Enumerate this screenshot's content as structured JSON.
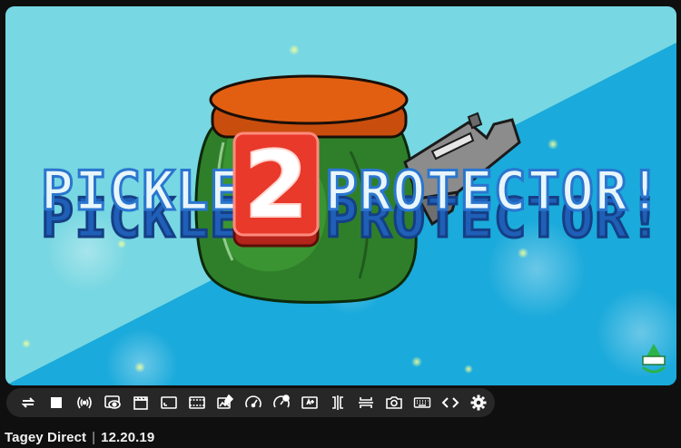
{
  "video": {
    "title_left": "PICKLE",
    "title_number": "2",
    "title_right": "PROTECTOR!",
    "colors": {
      "sky_light": "#77d7e2",
      "sky_dark": "#1aaadb",
      "lid": "#e25f12",
      "jar_green": "#2f7f2a",
      "title_fill": "#e8f6fb",
      "title_shadow": "#1f5fb7",
      "badge_red": "#e8392b"
    }
  },
  "controls": [
    {
      "name": "loop-icon"
    },
    {
      "name": "stop-icon"
    },
    {
      "name": "broadcast-icon"
    },
    {
      "name": "watch-icon"
    },
    {
      "name": "clapperboard-icon"
    },
    {
      "name": "screen-frame-icon"
    },
    {
      "name": "film-frame-icon"
    },
    {
      "name": "edit-image-icon"
    },
    {
      "name": "speed-gauge-icon"
    },
    {
      "name": "speed-settings-icon"
    },
    {
      "name": "enhance-icon"
    },
    {
      "name": "split-vertical-icon"
    },
    {
      "name": "split-horizontal-icon"
    },
    {
      "name": "camera-icon"
    },
    {
      "name": "keyboard-icon"
    },
    {
      "name": "code-icon"
    },
    {
      "name": "gear-icon"
    }
  ],
  "caption": {
    "channel": "Tagey Direct",
    "separator": "|",
    "date": "12.20.19"
  }
}
